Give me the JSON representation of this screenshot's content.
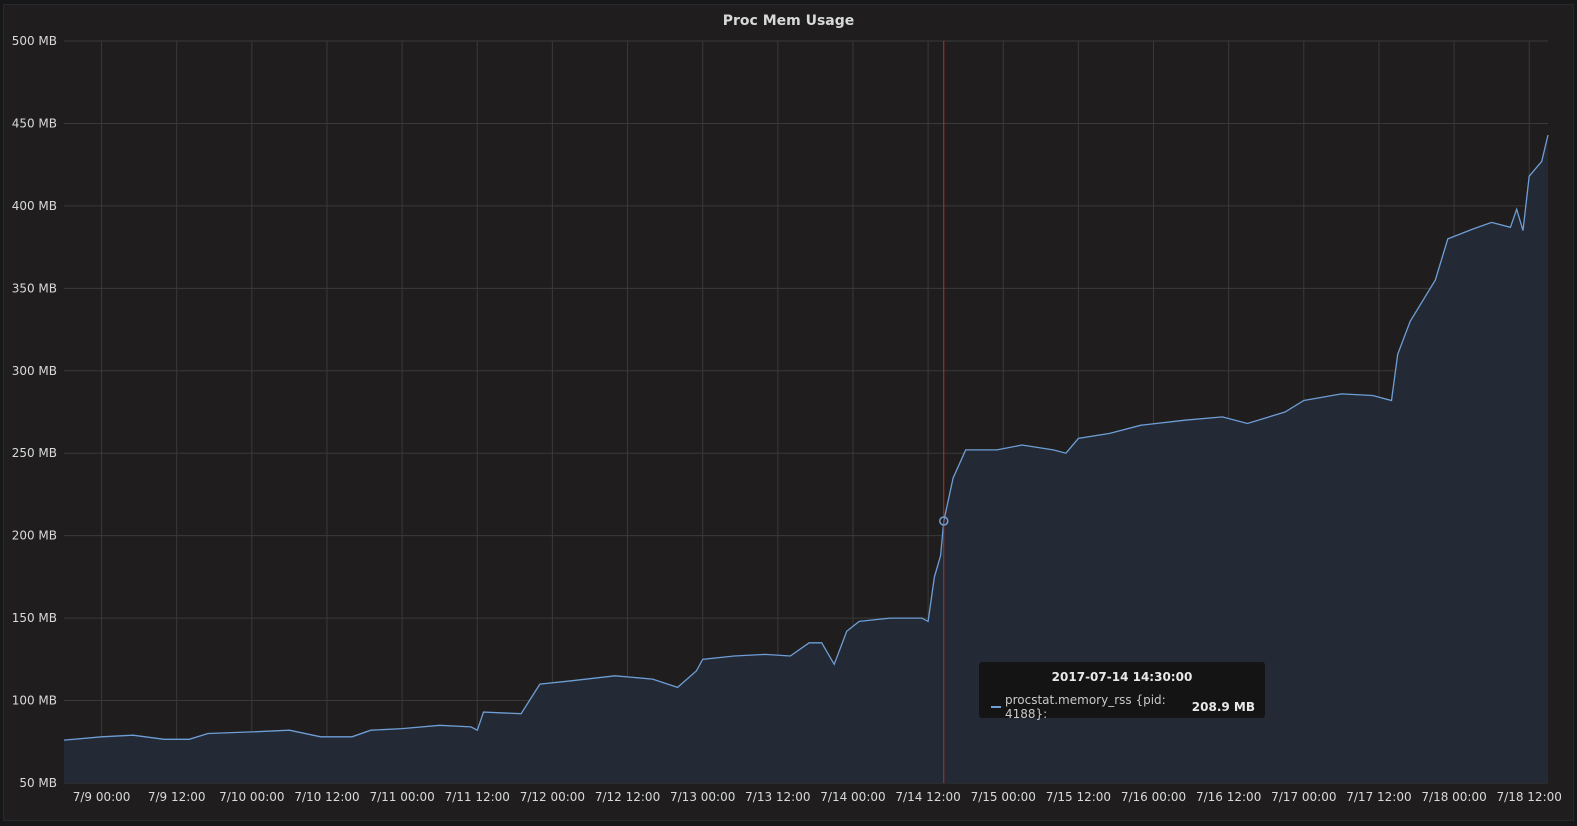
{
  "panel": {
    "title": "Proc Mem Usage"
  },
  "tooltip": {
    "time": "2017-07-14 14:30:00",
    "series": "procstat.memory_rss {pid: 4188}:",
    "value": "208.9 MB",
    "x": "2017-07-14T14:30:00",
    "y": 208.9
  },
  "colors": {
    "series": "#6e9ed6",
    "fill": "#232a36",
    "grid": "#3a3a3a",
    "crosshair": "#b93020",
    "background": "#1f1d1d"
  },
  "chart_data": {
    "type": "area",
    "title": "Proc Mem Usage",
    "xlabel": "",
    "ylabel": "",
    "x_range": [
      "2017-07-08T18:00:00",
      "2017-07-18T15:00:00"
    ],
    "ylim": [
      50,
      500
    ],
    "y_unit": "MB",
    "grid": true,
    "y_ticks": [
      50,
      100,
      150,
      200,
      250,
      300,
      350,
      400,
      450,
      500
    ],
    "y_tick_labels": [
      "50 MB",
      "100 MB",
      "150 MB",
      "200 MB",
      "250 MB",
      "300 MB",
      "350 MB",
      "400 MB",
      "450 MB",
      "500 MB"
    ],
    "x_ticks": [
      {
        "t": "2017-07-09T00:00:00",
        "label": "7/9 00:00"
      },
      {
        "t": "2017-07-09T12:00:00",
        "label": "7/9 12:00"
      },
      {
        "t": "2017-07-10T00:00:00",
        "label": "7/10 00:00"
      },
      {
        "t": "2017-07-10T12:00:00",
        "label": "7/10 12:00"
      },
      {
        "t": "2017-07-11T00:00:00",
        "label": "7/11 00:00"
      },
      {
        "t": "2017-07-11T12:00:00",
        "label": "7/11 12:00"
      },
      {
        "t": "2017-07-12T00:00:00",
        "label": "7/12 00:00"
      },
      {
        "t": "2017-07-12T12:00:00",
        "label": "7/12 12:00"
      },
      {
        "t": "2017-07-13T00:00:00",
        "label": "7/13 00:00"
      },
      {
        "t": "2017-07-13T12:00:00",
        "label": "7/13 12:00"
      },
      {
        "t": "2017-07-14T00:00:00",
        "label": "7/14 00:00"
      },
      {
        "t": "2017-07-14T12:00:00",
        "label": "7/14 12:00"
      },
      {
        "t": "2017-07-15T00:00:00",
        "label": "7/15 00:00"
      },
      {
        "t": "2017-07-15T12:00:00",
        "label": "7/15 12:00"
      },
      {
        "t": "2017-07-16T00:00:00",
        "label": "7/16 00:00"
      },
      {
        "t": "2017-07-16T12:00:00",
        "label": "7/16 12:00"
      },
      {
        "t": "2017-07-17T00:00:00",
        "label": "7/17 00:00"
      },
      {
        "t": "2017-07-17T12:00:00",
        "label": "7/17 12:00"
      },
      {
        "t": "2017-07-18T00:00:00",
        "label": "7/18 00:00"
      },
      {
        "t": "2017-07-18T12:00:00",
        "label": "7/18 12:00"
      }
    ],
    "series": [
      {
        "name": "procstat.memory_rss {pid: 4188}",
        "points": [
          [
            "2017-07-08T18:00:00",
            76
          ],
          [
            "2017-07-09T00:00:00",
            78
          ],
          [
            "2017-07-09T05:00:00",
            79
          ],
          [
            "2017-07-09T10:00:00",
            76.5
          ],
          [
            "2017-07-09T14:00:00",
            76.5
          ],
          [
            "2017-07-09T17:00:00",
            80
          ],
          [
            "2017-07-10T00:00:00",
            81
          ],
          [
            "2017-07-10T06:00:00",
            82
          ],
          [
            "2017-07-10T11:00:00",
            78
          ],
          [
            "2017-07-10T16:00:00",
            78
          ],
          [
            "2017-07-10T19:00:00",
            82
          ],
          [
            "2017-07-11T00:00:00",
            83
          ],
          [
            "2017-07-11T06:00:00",
            85
          ],
          [
            "2017-07-11T11:00:00",
            84
          ],
          [
            "2017-07-11T12:00:00",
            82
          ],
          [
            "2017-07-11T13:00:00",
            93
          ],
          [
            "2017-07-11T19:00:00",
            92
          ],
          [
            "2017-07-11T21:00:00",
            104
          ],
          [
            "2017-07-11T22:00:00",
            110
          ],
          [
            "2017-07-12T03:00:00",
            112
          ],
          [
            "2017-07-12T10:00:00",
            115
          ],
          [
            "2017-07-12T16:00:00",
            113
          ],
          [
            "2017-07-12T20:00:00",
            108
          ],
          [
            "2017-07-12T23:00:00",
            118
          ],
          [
            "2017-07-13T00:00:00",
            125
          ],
          [
            "2017-07-13T05:00:00",
            127
          ],
          [
            "2017-07-13T10:00:00",
            128
          ],
          [
            "2017-07-13T14:00:00",
            127
          ],
          [
            "2017-07-13T17:00:00",
            135
          ],
          [
            "2017-07-13T19:00:00",
            135
          ],
          [
            "2017-07-13T21:00:00",
            122
          ],
          [
            "2017-07-13T23:00:00",
            142
          ],
          [
            "2017-07-14T01:00:00",
            148
          ],
          [
            "2017-07-14T06:00:00",
            150
          ],
          [
            "2017-07-14T11:00:00",
            150
          ],
          [
            "2017-07-14T12:00:00",
            148
          ],
          [
            "2017-07-14T13:00:00",
            175
          ],
          [
            "2017-07-14T14:00:00",
            188
          ],
          [
            "2017-07-14T14:30:00",
            208.9
          ],
          [
            "2017-07-14T16:00:00",
            235
          ],
          [
            "2017-07-14T18:00:00",
            252
          ],
          [
            "2017-07-14T23:00:00",
            252
          ],
          [
            "2017-07-15T03:00:00",
            255
          ],
          [
            "2017-07-15T08:00:00",
            252
          ],
          [
            "2017-07-15T10:00:00",
            250
          ],
          [
            "2017-07-15T12:00:00",
            259
          ],
          [
            "2017-07-15T17:00:00",
            262
          ],
          [
            "2017-07-15T22:00:00",
            267
          ],
          [
            "2017-07-16T05:00:00",
            270
          ],
          [
            "2017-07-16T11:00:00",
            272
          ],
          [
            "2017-07-16T15:00:00",
            268
          ],
          [
            "2017-07-16T21:00:00",
            275
          ],
          [
            "2017-07-17T00:00:00",
            282
          ],
          [
            "2017-07-17T06:00:00",
            286
          ],
          [
            "2017-07-17T11:00:00",
            285
          ],
          [
            "2017-07-17T14:00:00",
            282
          ],
          [
            "2017-07-17T15:00:00",
            310
          ],
          [
            "2017-07-17T17:00:00",
            330
          ],
          [
            "2017-07-17T21:00:00",
            355
          ],
          [
            "2017-07-17T23:00:00",
            380
          ],
          [
            "2017-07-18T03:00:00",
            386
          ],
          [
            "2017-07-18T06:00:00",
            390
          ],
          [
            "2017-07-18T09:00:00",
            387
          ],
          [
            "2017-07-18T10:00:00",
            398
          ],
          [
            "2017-07-18T11:00:00",
            385
          ],
          [
            "2017-07-18T12:00:00",
            418
          ],
          [
            "2017-07-18T14:00:00",
            427
          ],
          [
            "2017-07-18T15:00:00",
            443
          ]
        ]
      }
    ]
  }
}
